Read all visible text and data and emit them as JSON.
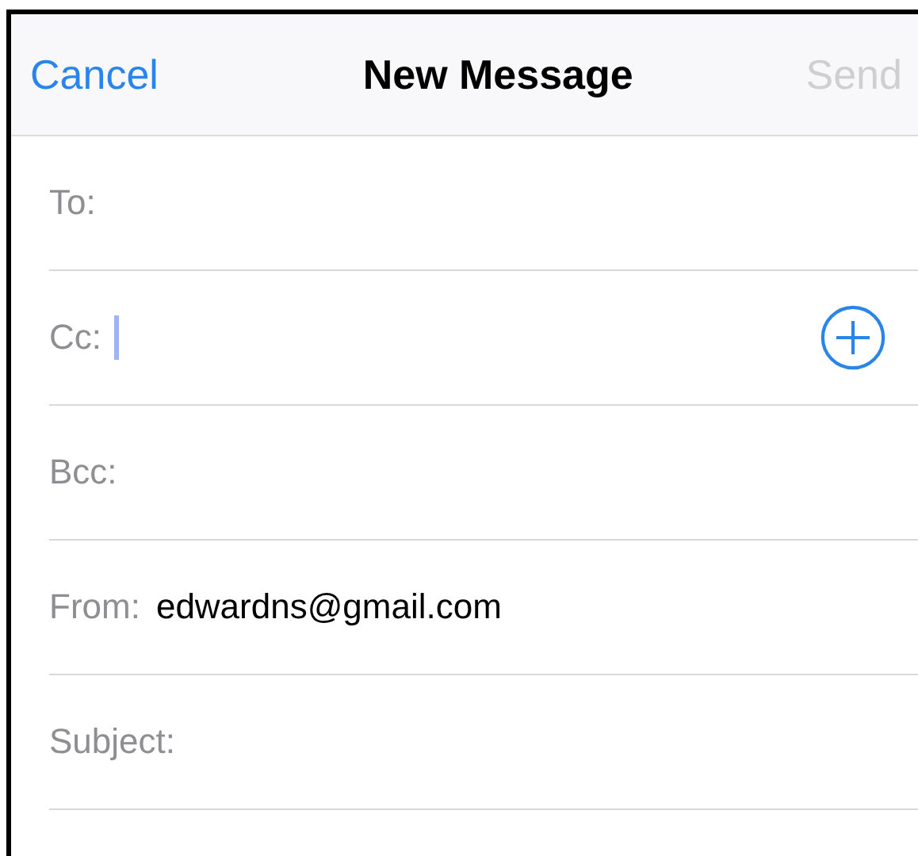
{
  "nav_bar": {
    "cancel": "Cancel",
    "title": "New Message",
    "send": {
      "label": "Send",
      "disabled": true
    }
  },
  "fields": [
    {
      "label": "To:",
      "focused": false,
      "add_button": false
    },
    {
      "label": "Cc:",
      "focused": true,
      "add_button": true
    },
    {
      "label": "Bcc:",
      "focused": false,
      "add_button": false
    },
    {
      "label": "From:",
      "value": "edwardns@gmail.com",
      "focused": false,
      "add_button": false
    },
    {
      "label": "Subject:",
      "focused": false,
      "add_button": false
    }
  ]
}
